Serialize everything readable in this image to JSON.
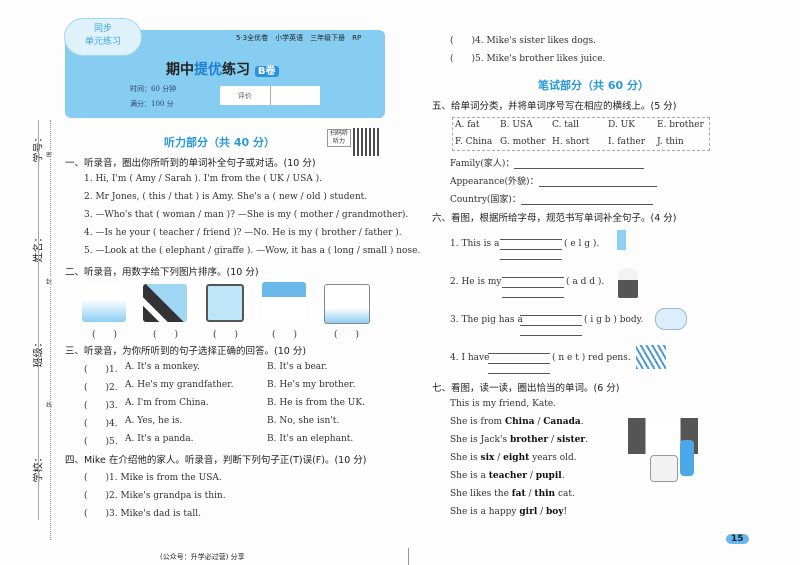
{
  "side": {
    "labels": [
      "学号：",
      "姓名：",
      "班级：",
      "学校："
    ],
    "seal": [
      "密",
      "封",
      "线"
    ]
  },
  "header": {
    "badge": [
      "同步",
      "单元练习"
    ],
    "series": "5·3全优卷　小学英语　三年级下册　RP",
    "title_a": "期中",
    "title_b": "提优",
    "title_c": "练习",
    "volume": "B卷",
    "time": "时间：60 分钟",
    "score": "满分：100 分",
    "rating_label": "评价",
    "qr_label": "扫码听听力"
  },
  "listening": {
    "title": "听力部分（共 40 分）",
    "s1": {
      "heading": "一、听录音，圈出你所听到的单词补全句子或对话。(10 分)",
      "items": [
        "1. Hi, I'm ( Amy / Sarah ). I'm from the ( UK / USA ).",
        "2. Mr Jones, ( this / that ) is Amy. She's a ( new / old ) student.",
        "3. —Who's that ( woman / man )? —She is my ( mother / grandmother).",
        "4. —Is he your ( teacher / friend )? —No. He is my ( brother / father ).",
        "5. —Look at the ( elephant / giraffe ). —Wow, it has a ( long / small ) nose."
      ]
    },
    "s2": {
      "heading": "二、听录音，用数字给下列图片排序。(10 分)",
      "blank": "(　　)"
    },
    "s3": {
      "heading": "三、听录音，为你所听到的句子选择正确的回答。(10 分)",
      "items": [
        {
          "n": "(　　)1.",
          "a": "A. It's a monkey.",
          "b": "B. It's a bear."
        },
        {
          "n": "(　　)2.",
          "a": "A. He's my grandfather.",
          "b": "B. He's my brother."
        },
        {
          "n": "(　　)3.",
          "a": "A. I'm from China.",
          "b": "B. He is from the UK."
        },
        {
          "n": "(　　)4.",
          "a": "A. Yes, he is.",
          "b": "B. No, she isn't."
        },
        {
          "n": "(　　)5.",
          "a": "A. It's a panda.",
          "b": "B. It's an elephant."
        }
      ]
    },
    "s4": {
      "heading": "四、Mike 在介绍他的家人。听录音，判断下列句子正(T)误(F)。(10 分)",
      "items": [
        "(　　)1. Mike is from the USA.",
        "(　　)2. Mike's grandpa is thin.",
        "(　　)3. Mike's dad is tall.",
        "(　　)4. Mike's sister likes dogs.",
        "(　　)5. Mike's brother likes juice."
      ]
    }
  },
  "writing": {
    "title": "笔试部分（共 60 分）",
    "s5": {
      "heading": "五、给单词分类，并将单词序号写在相应的横线上。(5 分)",
      "words": [
        "A. fat",
        "B. USA",
        "C. tall",
        "D. UK",
        "E. brother",
        "F. China",
        "G. mother",
        "H. short",
        "I. father",
        "J. thin"
      ],
      "family": "Family(家人)：",
      "appearance": "Appearance(外貌)：",
      "country": "Country(国家)："
    },
    "s6": {
      "heading": "六、看图，根据所给字母，规范书写单词补全句子。(4 分)",
      "items": [
        {
          "pre": "1. This is a",
          "hint": "( e l g ).",
          "post": ""
        },
        {
          "pre": "2. He is my",
          "hint": "( a d d ).",
          "post": ""
        },
        {
          "pre": "3. The pig has a",
          "hint": "( i g b ) body.",
          "post": ""
        },
        {
          "pre": "4. I have",
          "hint": "( n e t ) red pens.",
          "post": ""
        }
      ]
    },
    "s7": {
      "heading": "七、看图，读一读，圈出恰当的单词。(6 分)",
      "lines": [
        {
          "a": "This is my friend, Kate.",
          "w1": "",
          "s": "",
          "w2": "",
          "c": ""
        },
        {
          "a": "She is from ",
          "w1": "China",
          "s": " / ",
          "w2": "Canada",
          "c": "."
        },
        {
          "a": "She is Jack's ",
          "w1": "brother",
          "s": " / ",
          "w2": "sister",
          "c": "."
        },
        {
          "a": "She is ",
          "w1": "six",
          "s": " / ",
          "w2": "eight",
          "c": " years old."
        },
        {
          "a": "She is a ",
          "w1": "teacher",
          "s": " / ",
          "w2": "pupil",
          "c": "."
        },
        {
          "a": "She likes the ",
          "w1": "fat",
          "s": " / ",
          "w2": "thin",
          "c": " cat."
        },
        {
          "a": "She is a happy ",
          "w1": "girl",
          "s": " / ",
          "w2": "boy",
          "c": "!"
        }
      ]
    }
  },
  "footer": {
    "note": "(公众号：升学必过营) 分享",
    "page": "15"
  }
}
